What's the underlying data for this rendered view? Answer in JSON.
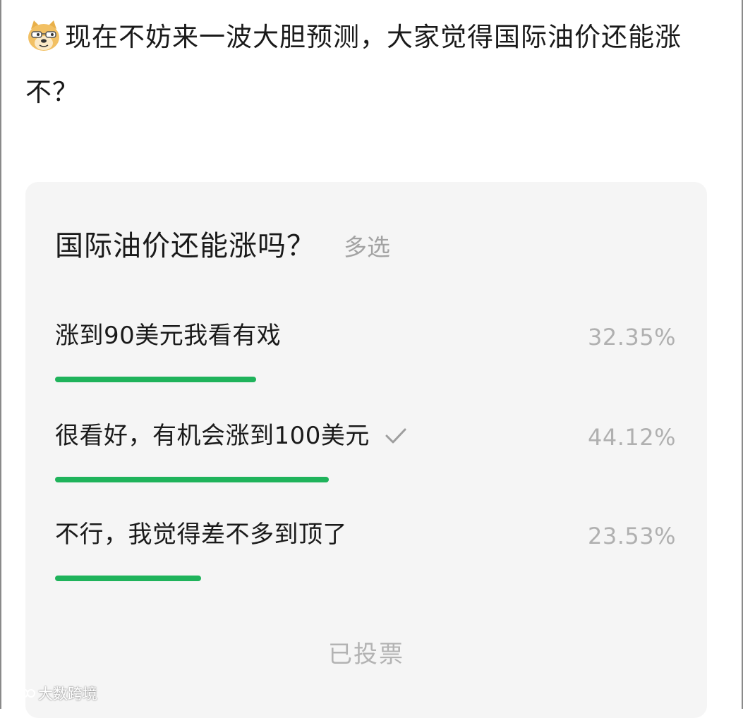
{
  "post": {
    "emoji_icon": "doge-emoji-icon",
    "text": "现在不妨来一波大胆预测，大家觉得国际油价还能涨不？"
  },
  "poll": {
    "question": "国际油价还能涨吗？",
    "type_label": "多选",
    "options": [
      {
        "label": "涨到90美元我看有戏",
        "percent_text": "32.35%",
        "percent": 32.35,
        "selected": false
      },
      {
        "label": "很看好，有机会涨到100美元",
        "percent_text": "44.12%",
        "percent": 44.12,
        "selected": true
      },
      {
        "label": "不行，我觉得差不多到顶了",
        "percent_text": "23.53%",
        "percent": 23.53,
        "selected": false
      }
    ],
    "status": "已投票",
    "bar_color": "#1fb35b",
    "check_icon": "checkmark-icon"
  },
  "watermark": {
    "text": "大数跨境"
  }
}
